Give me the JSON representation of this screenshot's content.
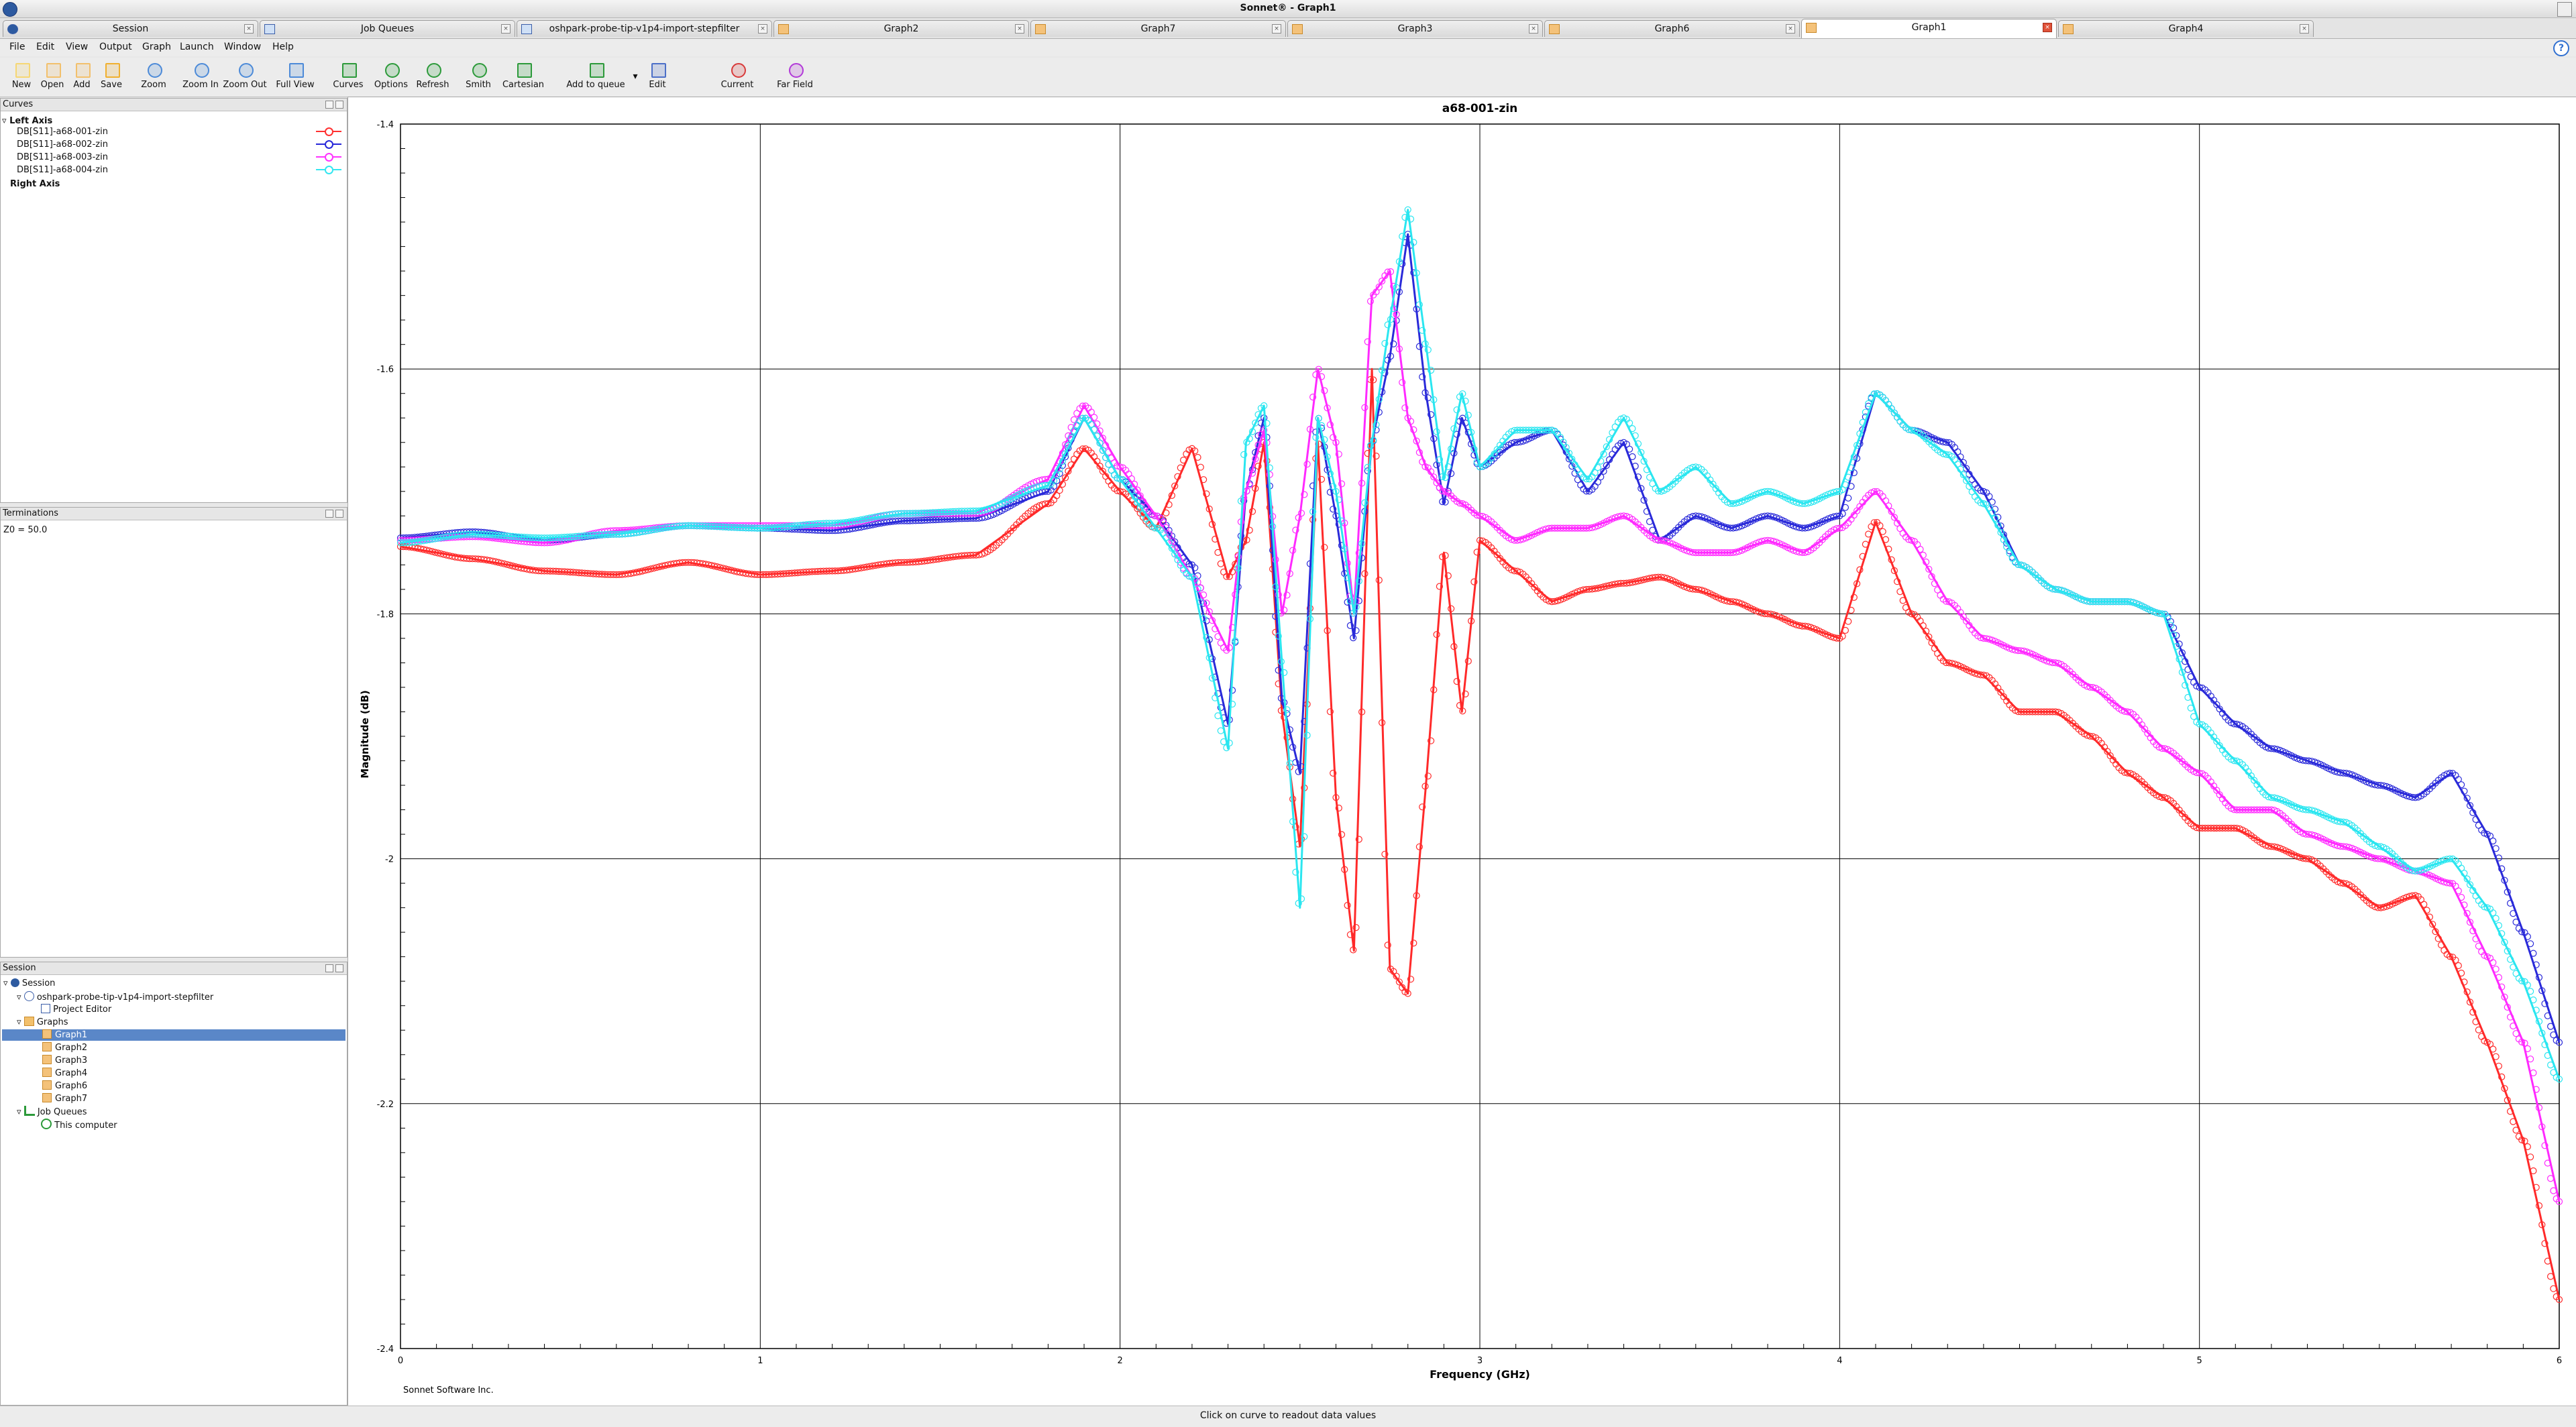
{
  "window": {
    "title": "Sonnet® - Graph1"
  },
  "tabs": [
    {
      "label": "Session",
      "icon": "sonnet-icon"
    },
    {
      "label": "Job Queues",
      "icon": "job-queue-icon"
    },
    {
      "label": "oshpark-probe-tip-v1p4-import-stepfilter",
      "icon": "project-icon"
    },
    {
      "label": "Graph2",
      "icon": "graph-icon"
    },
    {
      "label": "Graph7",
      "icon": "graph-icon"
    },
    {
      "label": "Graph3",
      "icon": "graph-icon"
    },
    {
      "label": "Graph6",
      "icon": "graph-icon"
    },
    {
      "label": "Graph1",
      "icon": "graph-icon",
      "active": true
    },
    {
      "label": "Graph4",
      "icon": "graph-icon"
    }
  ],
  "menu": [
    "File",
    "Edit",
    "View",
    "Output",
    "Graph",
    "Launch",
    "Window",
    "Help"
  ],
  "toolbar": [
    {
      "label": "New",
      "icon": "new-file-icon"
    },
    {
      "label": "Open",
      "icon": "open-folder-icon"
    },
    {
      "label": "Add",
      "icon": "add-folder-icon"
    },
    {
      "label": "Save",
      "icon": "save-icon"
    },
    {
      "label": "Zoom",
      "icon": "zoom-icon"
    },
    {
      "label": "Zoom In",
      "icon": "zoom-in-icon"
    },
    {
      "label": "Zoom Out",
      "icon": "zoom-out-icon"
    },
    {
      "label": "Full View",
      "icon": "full-view-icon"
    },
    {
      "label": "Curves",
      "icon": "curves-icon"
    },
    {
      "label": "Options",
      "icon": "options-icon"
    },
    {
      "label": "Refresh",
      "icon": "refresh-icon"
    },
    {
      "label": "Smith",
      "icon": "smith-chart-icon"
    },
    {
      "label": "Cartesian",
      "icon": "cartesian-icon"
    },
    {
      "label": "Add to queue",
      "icon": "add-to-queue-icon"
    },
    {
      "label": "Edit",
      "icon": "edit-icon"
    },
    {
      "label": "Current",
      "icon": "current-icon"
    },
    {
      "label": "Far Field",
      "icon": "far-field-icon"
    }
  ],
  "curves_panel": {
    "title": "Curves",
    "left_axis": "Left Axis",
    "right_axis": "Right Axis",
    "items": [
      {
        "label": "DB[S11]-a68-001-zin",
        "color": "#ff3030"
      },
      {
        "label": "DB[S11]-a68-002-zin",
        "color": "#2626d9"
      },
      {
        "label": "DB[S11]-a68-003-zin",
        "color": "#ff33ff"
      },
      {
        "label": "DB[S11]-a68-004-zin",
        "color": "#33e6f0"
      }
    ]
  },
  "terminations_panel": {
    "title": "Terminations",
    "z0": "Z0 = 50.0"
  },
  "session_panel": {
    "title": "Session",
    "root": "Session",
    "project": "oshpark-probe-tip-v1p4-import-stepfilter",
    "project_editor": "Project Editor",
    "graphs_label": "Graphs",
    "graphs": [
      "Graph1",
      "Graph2",
      "Graph3",
      "Graph4",
      "Graph6",
      "Graph7"
    ],
    "selected_graph": "Graph1",
    "job_queues_label": "Job Queues",
    "computer": "This computer"
  },
  "graph": {
    "footer": "Sonnet Software Inc."
  },
  "status": "Click on curve to readout data values",
  "chart_data": {
    "type": "line",
    "title": "a68-001-zin",
    "xlabel": "Frequency (GHz)",
    "ylabel": "Magnitude (dB)",
    "xlim": [
      0,
      6
    ],
    "ylim": [
      -2.4,
      -1.4
    ],
    "xticks": [
      "0",
      "1",
      "2",
      "3",
      "4",
      "5",
      "6"
    ],
    "yticks": [
      "-1.4",
      "-1.6",
      "-1.8",
      "-2",
      "-2.2",
      "-2.4"
    ],
    "grid": true,
    "x": [
      0,
      0.2,
      0.4,
      0.6,
      0.8,
      1.0,
      1.2,
      1.4,
      1.6,
      1.8,
      1.9,
      2.0,
      2.1,
      2.2,
      2.3,
      2.35,
      2.4,
      2.45,
      2.5,
      2.55,
      2.6,
      2.65,
      2.7,
      2.75,
      2.8,
      2.85,
      2.9,
      2.95,
      3.0,
      3.1,
      3.2,
      3.3,
      3.4,
      3.5,
      3.6,
      3.7,
      3.8,
      3.9,
      4.0,
      4.1,
      4.2,
      4.3,
      4.4,
      4.5,
      4.6,
      4.7,
      4.8,
      4.9,
      5.0,
      5.1,
      5.2,
      5.3,
      5.4,
      5.5,
      5.6,
      5.7,
      5.8,
      5.9,
      6.0
    ],
    "series": [
      {
        "name": "DB[S11]-a68-001-zin",
        "color": "#ff2a2a",
        "values": [
          -1.745,
          -1.755,
          -1.765,
          -1.768,
          -1.758,
          -1.768,
          -1.765,
          -1.758,
          -1.752,
          -1.71,
          -1.665,
          -1.7,
          -1.73,
          -1.665,
          -1.77,
          -1.74,
          -1.66,
          -1.88,
          -1.99,
          -1.66,
          -1.95,
          -2.075,
          -1.6,
          -2.09,
          -2.11,
          -1.94,
          -1.75,
          -1.88,
          -1.74,
          -1.765,
          -1.79,
          -1.78,
          -1.775,
          -1.77,
          -1.78,
          -1.79,
          -1.8,
          -1.81,
          -1.82,
          -1.725,
          -1.8,
          -1.84,
          -1.85,
          -1.88,
          -1.88,
          -1.9,
          -1.93,
          -1.95,
          -1.975,
          -1.975,
          -1.99,
          -2.0,
          -2.02,
          -2.04,
          -2.03,
          -2.08,
          -2.15,
          -2.23,
          -2.36
        ]
      },
      {
        "name": "DB[S11]-a68-002-zin",
        "color": "#2a2ad9",
        "values": [
          -1.738,
          -1.733,
          -1.74,
          -1.735,
          -1.728,
          -1.73,
          -1.732,
          -1.724,
          -1.722,
          -1.7,
          -1.64,
          -1.69,
          -1.72,
          -1.76,
          -1.89,
          -1.7,
          -1.64,
          -1.87,
          -1.93,
          -1.64,
          -1.72,
          -1.82,
          -1.66,
          -1.59,
          -1.49,
          -1.62,
          -1.71,
          -1.64,
          -1.68,
          -1.66,
          -1.65,
          -1.7,
          -1.66,
          -1.74,
          -1.72,
          -1.73,
          -1.72,
          -1.73,
          -1.72,
          -1.62,
          -1.65,
          -1.66,
          -1.7,
          -1.76,
          -1.78,
          -1.79,
          -1.79,
          -1.8,
          -1.86,
          -1.89,
          -1.91,
          -1.92,
          -1.93,
          -1.94,
          -1.95,
          -1.93,
          -1.98,
          -2.06,
          -2.15
        ]
      },
      {
        "name": "DB[S11]-a68-003-zin",
        "color": "#ff2aff",
        "values": [
          -1.74,
          -1.737,
          -1.742,
          -1.732,
          -1.728,
          -1.728,
          -1.728,
          -1.718,
          -1.718,
          -1.69,
          -1.63,
          -1.68,
          -1.72,
          -1.77,
          -1.83,
          -1.7,
          -1.65,
          -1.8,
          -1.72,
          -1.6,
          -1.66,
          -1.8,
          -1.54,
          -1.52,
          -1.64,
          -1.68,
          -1.7,
          -1.71,
          -1.72,
          -1.74,
          -1.73,
          -1.73,
          -1.72,
          -1.74,
          -1.75,
          -1.75,
          -1.74,
          -1.75,
          -1.73,
          -1.7,
          -1.74,
          -1.79,
          -1.82,
          -1.83,
          -1.84,
          -1.86,
          -1.88,
          -1.91,
          -1.93,
          -1.96,
          -1.96,
          -1.98,
          -1.99,
          -2.0,
          -2.01,
          -2.02,
          -2.08,
          -2.15,
          -2.28
        ]
      },
      {
        "name": "DB[S11]-a68-004-zin",
        "color": "#2ae6f0",
        "values": [
          -1.742,
          -1.735,
          -1.738,
          -1.735,
          -1.728,
          -1.73,
          -1.726,
          -1.718,
          -1.716,
          -1.695,
          -1.64,
          -1.69,
          -1.73,
          -1.77,
          -1.91,
          -1.66,
          -1.63,
          -1.84,
          -2.04,
          -1.64,
          -1.7,
          -1.8,
          -1.66,
          -1.56,
          -1.47,
          -1.58,
          -1.69,
          -1.62,
          -1.68,
          -1.65,
          -1.65,
          -1.69,
          -1.64,
          -1.7,
          -1.68,
          -1.71,
          -1.7,
          -1.71,
          -1.7,
          -1.62,
          -1.65,
          -1.67,
          -1.71,
          -1.76,
          -1.78,
          -1.79,
          -1.79,
          -1.8,
          -1.89,
          -1.92,
          -1.95,
          -1.96,
          -1.97,
          -1.99,
          -2.01,
          -2.0,
          -2.04,
          -2.1,
          -2.18
        ]
      }
    ]
  }
}
